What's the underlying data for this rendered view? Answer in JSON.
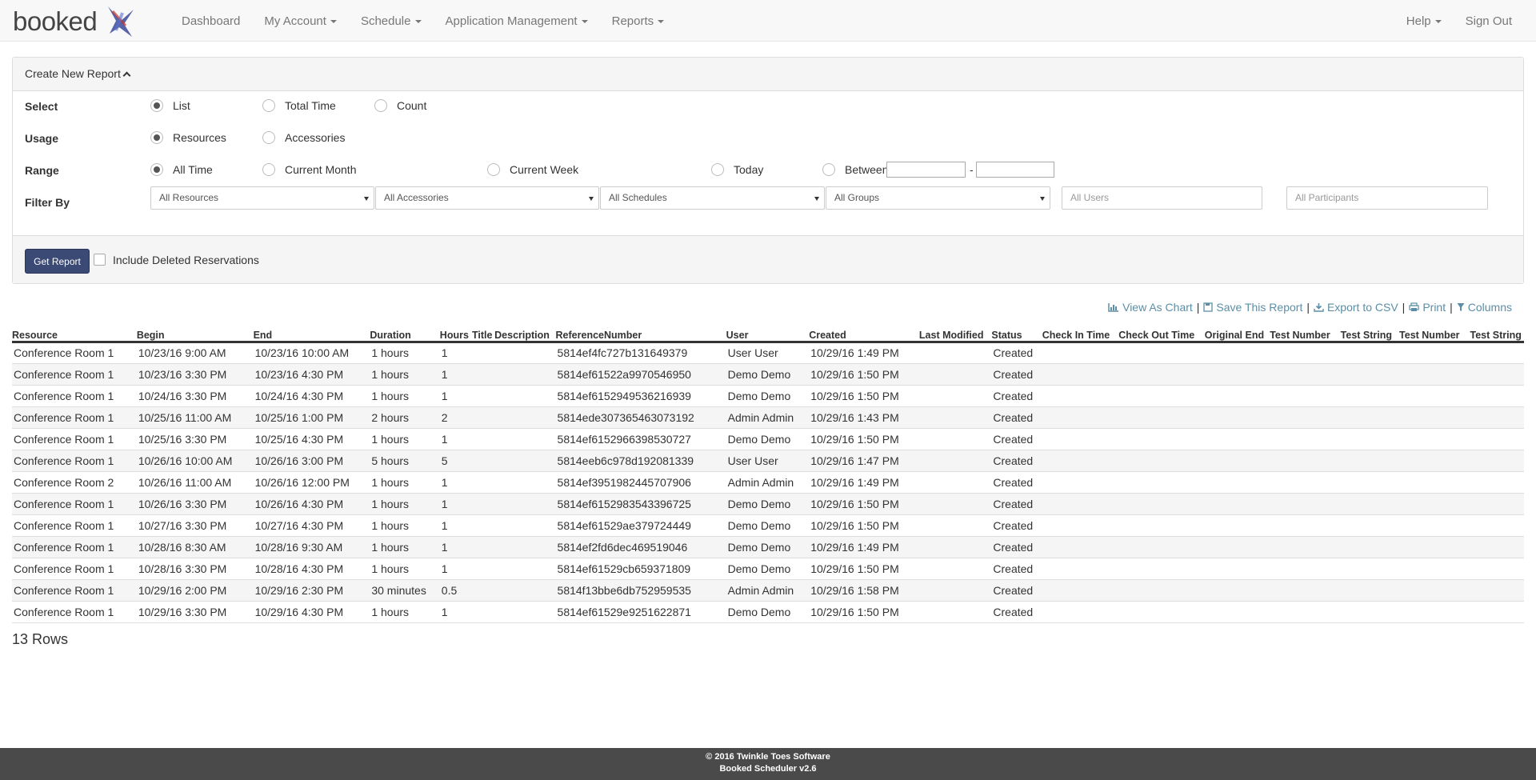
{
  "brand": {
    "name": "booked"
  },
  "nav": {
    "left": [
      {
        "label": "Dashboard",
        "dropdown": false
      },
      {
        "label": "My Account",
        "dropdown": true
      },
      {
        "label": "Schedule",
        "dropdown": true
      },
      {
        "label": "Application Management",
        "dropdown": true
      },
      {
        "label": "Reports",
        "dropdown": true
      }
    ],
    "right": [
      {
        "label": "Help",
        "dropdown": true
      },
      {
        "label": "Sign Out",
        "dropdown": false
      }
    ]
  },
  "report_form": {
    "heading": "Create New Report",
    "select": {
      "label": "Select",
      "options": [
        "List",
        "Total Time",
        "Count"
      ],
      "selected": "List"
    },
    "usage": {
      "label": "Usage",
      "options": [
        "Resources",
        "Accessories"
      ],
      "selected": "Resources"
    },
    "range": {
      "label": "Range",
      "options": [
        "All Time",
        "Current Month",
        "Current Week",
        "Today",
        "Between"
      ],
      "selected": "All Time",
      "between_separator": "-"
    },
    "filter": {
      "label": "Filter By",
      "resources": "All Resources",
      "accessories": "All Accessories",
      "schedules": "All Schedules",
      "groups": "All Groups",
      "users_placeholder": "All Users",
      "participants_placeholder": "All Participants"
    },
    "get_report_label": "Get Report",
    "include_deleted_label": "Include Deleted Reservations",
    "include_deleted_checked": false
  },
  "actions": {
    "view_chart": "View As Chart",
    "save_report": "Save This Report",
    "export_csv": "Export to CSV",
    "print": "Print",
    "columns": "Columns",
    "separator": "|"
  },
  "table": {
    "headers": [
      "Resource",
      "Begin",
      "End",
      "Duration",
      "Hours",
      "Title",
      "Description",
      "ReferenceNumber",
      "User",
      "Created",
      "Last Modified",
      "Status",
      "Check In Time",
      "Check Out Time",
      "Original End",
      "Test Number",
      "Test String",
      "Test Number",
      "Test String"
    ],
    "rows": [
      [
        "Conference Room 1",
        "10/23/16 9:00 AM",
        "10/23/16 10:00 AM",
        "1 hours",
        "1",
        "",
        "",
        "5814ef4fc727b131649379",
        "User User",
        "10/29/16 1:49 PM",
        "",
        "Created",
        "",
        "",
        "",
        "",
        "",
        "",
        ""
      ],
      [
        "Conference Room 1",
        "10/23/16 3:30 PM",
        "10/23/16 4:30 PM",
        "1 hours",
        "1",
        "",
        "",
        "5814ef61522a9970546950",
        "Demo Demo",
        "10/29/16 1:50 PM",
        "",
        "Created",
        "",
        "",
        "",
        "",
        "",
        "",
        ""
      ],
      [
        "Conference Room 1",
        "10/24/16 3:30 PM",
        "10/24/16 4:30 PM",
        "1 hours",
        "1",
        "",
        "",
        "5814ef6152949536216939",
        "Demo Demo",
        "10/29/16 1:50 PM",
        "",
        "Created",
        "",
        "",
        "",
        "",
        "",
        "",
        ""
      ],
      [
        "Conference Room 1",
        "10/25/16 11:00 AM",
        "10/25/16 1:00 PM",
        "2 hours",
        "2",
        "",
        "",
        "5814ede307365463073192",
        "Admin Admin",
        "10/29/16 1:43 PM",
        "",
        "Created",
        "",
        "",
        "",
        "",
        "",
        "",
        ""
      ],
      [
        "Conference Room 1",
        "10/25/16 3:30 PM",
        "10/25/16 4:30 PM",
        "1 hours",
        "1",
        "",
        "",
        "5814ef6152966398530727",
        "Demo Demo",
        "10/29/16 1:50 PM",
        "",
        "Created",
        "",
        "",
        "",
        "",
        "",
        "",
        ""
      ],
      [
        "Conference Room 1",
        "10/26/16 10:00 AM",
        "10/26/16 3:00 PM",
        "5 hours",
        "5",
        "",
        "",
        "5814eeb6c978d192081339",
        "User User",
        "10/29/16 1:47 PM",
        "",
        "Created",
        "",
        "",
        "",
        "",
        "",
        "",
        ""
      ],
      [
        "Conference Room 2",
        "10/26/16 11:00 AM",
        "10/26/16 12:00 PM",
        "1 hours",
        "1",
        "",
        "",
        "5814ef3951982445707906",
        "Admin Admin",
        "10/29/16 1:49 PM",
        "",
        "Created",
        "",
        "",
        "",
        "",
        "",
        "",
        ""
      ],
      [
        "Conference Room 1",
        "10/26/16 3:30 PM",
        "10/26/16 4:30 PM",
        "1 hours",
        "1",
        "",
        "",
        "5814ef6152983543396725",
        "Demo Demo",
        "10/29/16 1:50 PM",
        "",
        "Created",
        "",
        "",
        "",
        "",
        "",
        "",
        ""
      ],
      [
        "Conference Room 1",
        "10/27/16 3:30 PM",
        "10/27/16 4:30 PM",
        "1 hours",
        "1",
        "",
        "",
        "5814ef61529ae379724449",
        "Demo Demo",
        "10/29/16 1:50 PM",
        "",
        "Created",
        "",
        "",
        "",
        "",
        "",
        "",
        ""
      ],
      [
        "Conference Room 1",
        "10/28/16 8:30 AM",
        "10/28/16 9:30 AM",
        "1 hours",
        "1",
        "",
        "",
        "5814ef2fd6dec469519046",
        "Demo Demo",
        "10/29/16 1:49 PM",
        "",
        "Created",
        "",
        "",
        "",
        "",
        "",
        "",
        ""
      ],
      [
        "Conference Room 1",
        "10/28/16 3:30 PM",
        "10/28/16 4:30 PM",
        "1 hours",
        "1",
        "",
        "",
        "5814ef61529cb659371809",
        "Demo Demo",
        "10/29/16 1:50 PM",
        "",
        "Created",
        "",
        "",
        "",
        "",
        "",
        "",
        ""
      ],
      [
        "Conference Room 1",
        "10/29/16 2:00 PM",
        "10/29/16 2:30 PM",
        "30 minutes",
        "0.5",
        "",
        "",
        "5814f13bbe6db752959535",
        "Admin Admin",
        "10/29/16 1:58 PM",
        "",
        "Created",
        "",
        "",
        "",
        "",
        "",
        "",
        ""
      ],
      [
        "Conference Room 1",
        "10/29/16 3:30 PM",
        "10/29/16 4:30 PM",
        "1 hours",
        "1",
        "",
        "",
        "5814ef61529e9251622871",
        "Demo Demo",
        "10/29/16 1:50 PM",
        "",
        "Created",
        "",
        "",
        "",
        "",
        "",
        "",
        ""
      ]
    ],
    "row_count_label": "13 Rows"
  },
  "footer": {
    "copyright": "© 2016 Twinkle Toes Software",
    "version": "Booked Scheduler v2.6"
  },
  "colors": {
    "primary_button": "#3b4a75",
    "link": "#5b8ea6",
    "footer_bg": "#4a4a4a",
    "navbar_bg": "#f8f8f8"
  }
}
